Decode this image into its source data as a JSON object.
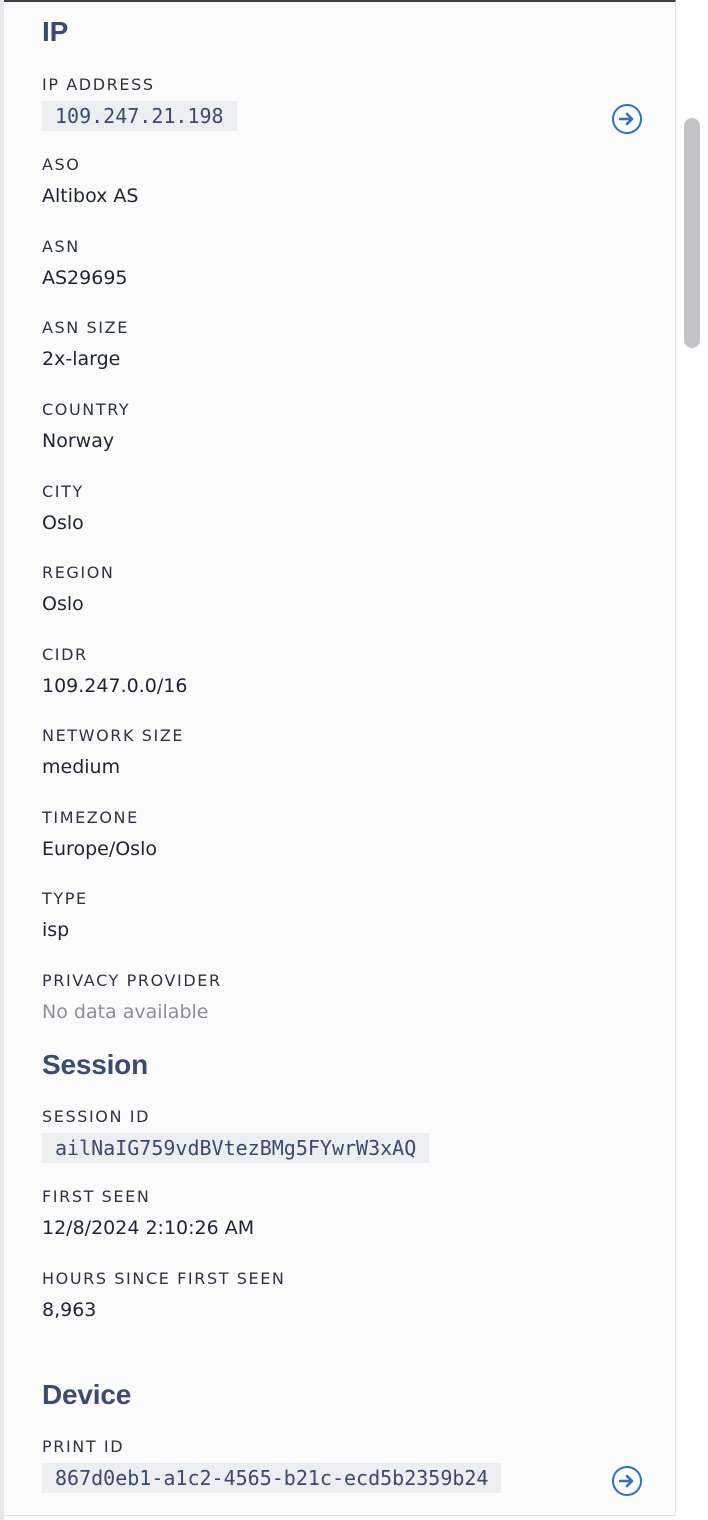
{
  "ip_section": {
    "title": "IP",
    "ip_address": {
      "label": "IP ADDRESS",
      "value": "109.247.21.198",
      "action_icon": "arrow-right-circle-icon"
    },
    "aso": {
      "label": "ASO",
      "value": "Altibox AS"
    },
    "asn": {
      "label": "ASN",
      "value": "AS29695"
    },
    "asn_size": {
      "label": "ASN SIZE",
      "value": "2x-large"
    },
    "country": {
      "label": "COUNTRY",
      "value": "Norway"
    },
    "city": {
      "label": "CITY",
      "value": "Oslo"
    },
    "region": {
      "label": "REGION",
      "value": "Oslo"
    },
    "cidr": {
      "label": "CIDR",
      "value": "109.247.0.0/16"
    },
    "network_size": {
      "label": "NETWORK SIZE",
      "value": "medium"
    },
    "timezone": {
      "label": "TIMEZONE",
      "value": "Europe/Oslo"
    },
    "type": {
      "label": "TYPE",
      "value": "isp"
    },
    "privacy_provider": {
      "label": "PRIVACY PROVIDER",
      "value": "No data available"
    }
  },
  "session_section": {
    "title": "Session",
    "session_id": {
      "label": "SESSION ID",
      "value": "ailNaIG759vdBVtezBMg5FYwrW3xAQ"
    },
    "first_seen": {
      "label": "FIRST SEEN",
      "value": "12/8/2024 2:10:26 AM"
    },
    "hours_since_first_seen": {
      "label": "HOURS SINCE FIRST SEEN",
      "value": "8,963"
    }
  },
  "device_section": {
    "title": "Device",
    "print_id": {
      "label": "PRINT ID",
      "value": "867d0eb1-a1c2-4565-b21c-ecd5b2359b24",
      "action_icon": "arrow-right-circle-icon"
    }
  },
  "colors": {
    "heading": "#3b4b72",
    "accent_link": "#2f6fd0",
    "code_background": "#eceef1",
    "muted_text": "#8b8f99"
  }
}
